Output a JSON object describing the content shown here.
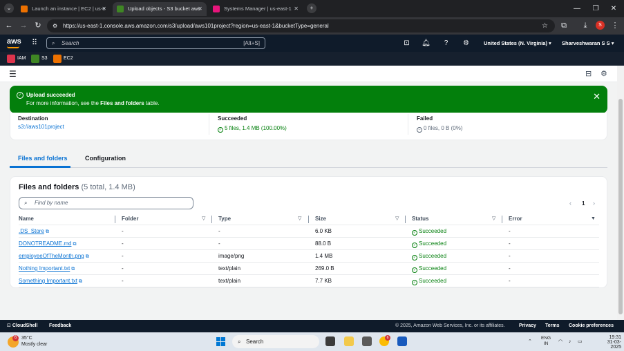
{
  "browser": {
    "tabs": [
      {
        "label": "Launch an instance | EC2 | us-e",
        "active": false
      },
      {
        "label": "Upload objects - S3 bucket aws",
        "active": true
      },
      {
        "label": "Systems Manager | us-east-1",
        "active": false
      }
    ],
    "url": "https://us-east-1.console.aws.amazon.com/s3/upload/aws101project?region=us-east-1&bucketType=general",
    "profile_initial": "S"
  },
  "aws_nav": {
    "logo": "aws",
    "search_placeholder": "Search",
    "search_shortcut": "[Alt+S]",
    "region": "United States (N. Virginia)",
    "user": "Sharveshwaran S S"
  },
  "favorites": [
    {
      "label": "IAM",
      "color": "#dd344c"
    },
    {
      "label": "S3",
      "color": "#3f8624"
    },
    {
      "label": "EC2",
      "color": "#ed7100"
    }
  ],
  "flash": {
    "title": "Upload succeeded",
    "message_prefix": "For more information, see the ",
    "message_bold": "Files and folders",
    "message_suffix": " table."
  },
  "summary": {
    "destination_label": "Destination",
    "destination_value": "s3://aws101project",
    "succeeded_label": "Succeeded",
    "succeeded_value": "5 files, 1.4 MB (100.00%)",
    "failed_label": "Failed",
    "failed_value": "0 files, 0 B (0%)"
  },
  "content_tabs": [
    {
      "label": "Files and folders",
      "active": true
    },
    {
      "label": "Configuration",
      "active": false
    }
  ],
  "files_panel": {
    "title": "Files and folders",
    "count": "(5 total, 1.4 MB)",
    "find_placeholder": "Find by name",
    "page": "1",
    "columns": [
      "Name",
      "Folder",
      "Type",
      "Size",
      "Status",
      "Error"
    ],
    "rows": [
      {
        "name": ".DS_Store",
        "folder": "-",
        "type": "-",
        "size": "6.0 KB",
        "status": "Succeeded",
        "error": "-"
      },
      {
        "name": "DONOTREADME.md",
        "folder": "-",
        "type": "-",
        "size": "88.0 B",
        "status": "Succeeded",
        "error": "-"
      },
      {
        "name": "employeeOfTheMonth.png",
        "folder": "-",
        "type": "image/png",
        "size": "1.4 MB",
        "status": "Succeeded",
        "error": "-"
      },
      {
        "name": "Nothing Important.txt",
        "folder": "-",
        "type": "text/plain",
        "size": "269.0 B",
        "status": "Succeeded",
        "error": "-"
      },
      {
        "name": "Something Important.txt",
        "folder": "-",
        "type": "text/plain",
        "size": "7.7 KB",
        "status": "Succeeded",
        "error": "-"
      }
    ]
  },
  "footer": {
    "cloudshell": "CloudShell",
    "feedback": "Feedback",
    "copyright": "© 2025, Amazon Web Services, Inc. or its affiliates.",
    "privacy": "Privacy",
    "terms": "Terms",
    "cookie": "Cookie preferences"
  },
  "taskbar": {
    "weather_badge": "6",
    "temperature": "35°C",
    "weather": "Mostly clear",
    "search": "Search",
    "lang1": "ENG",
    "lang2": "IN",
    "time": "19:31",
    "date": "31-03-2025",
    "chrome_badge": "6"
  },
  "colors": {
    "success": "#037f0c",
    "link": "#0972d3",
    "aws_nav": "#0f1b2a"
  }
}
